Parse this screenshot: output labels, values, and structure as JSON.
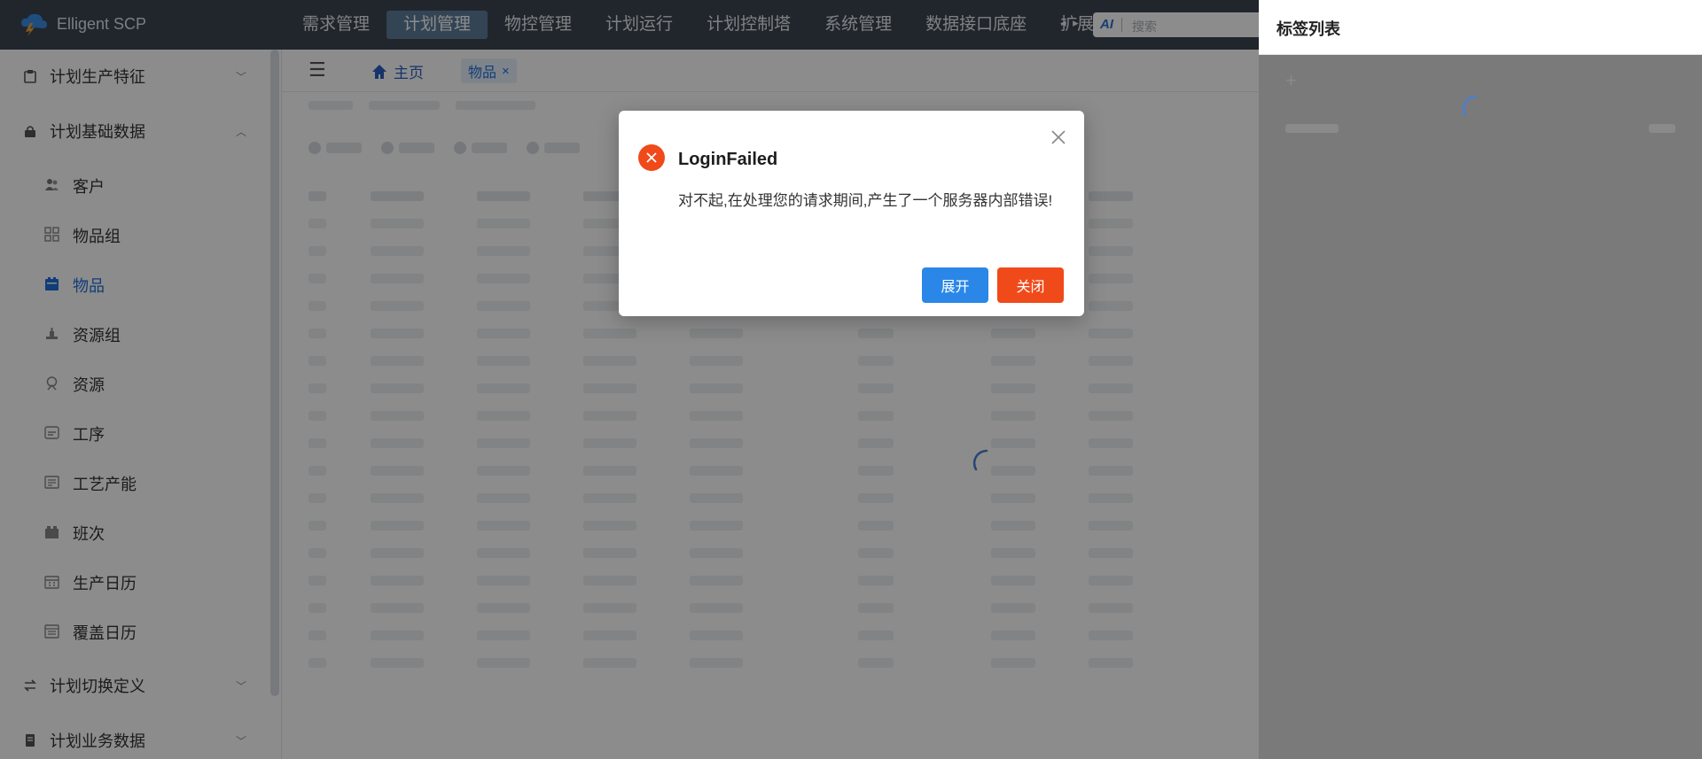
{
  "app": {
    "brand": "Elligent SCP"
  },
  "topnav": {
    "items": [
      "需求管理",
      "计划管理",
      "物控管理",
      "计划运行",
      "计划控制塔",
      "系统管理",
      "数据接口底座",
      "扩展"
    ],
    "active_index": 1,
    "search_placeholder": "搜索",
    "ai_label": "AI"
  },
  "sidebar": {
    "groups": [
      {
        "label": "计划生产特征",
        "expanded": false
      },
      {
        "label": "计划基础数据",
        "expanded": true
      },
      {
        "label": "计划切换定义",
        "expanded": false
      },
      {
        "label": "计划业务数据",
        "expanded": false
      }
    ],
    "items": [
      {
        "label": "客户",
        "icon": "customer-icon"
      },
      {
        "label": "物品组",
        "icon": "item-group-icon"
      },
      {
        "label": "物品",
        "icon": "item-icon",
        "active": true
      },
      {
        "label": "资源组",
        "icon": "resource-group-icon"
      },
      {
        "label": "资源",
        "icon": "resource-icon"
      },
      {
        "label": "工序",
        "icon": "process-icon"
      },
      {
        "label": "工艺产能",
        "icon": "capacity-icon"
      },
      {
        "label": "班次",
        "icon": "shift-icon"
      },
      {
        "label": "生产日历",
        "icon": "calendar-icon"
      },
      {
        "label": "覆盖日历",
        "icon": "override-calendar-icon"
      }
    ]
  },
  "tabs": {
    "home": "主页",
    "current": "物品"
  },
  "drawer": {
    "title": "标签列表"
  },
  "modal": {
    "title": "LoginFailed",
    "message": "对不起,在处理您的请求期间,产生了一个服务器内部错误!",
    "expand_label": "展开",
    "close_label": "关闭",
    "error_color": "#f04a1a",
    "primary_color": "#2a87e8"
  }
}
